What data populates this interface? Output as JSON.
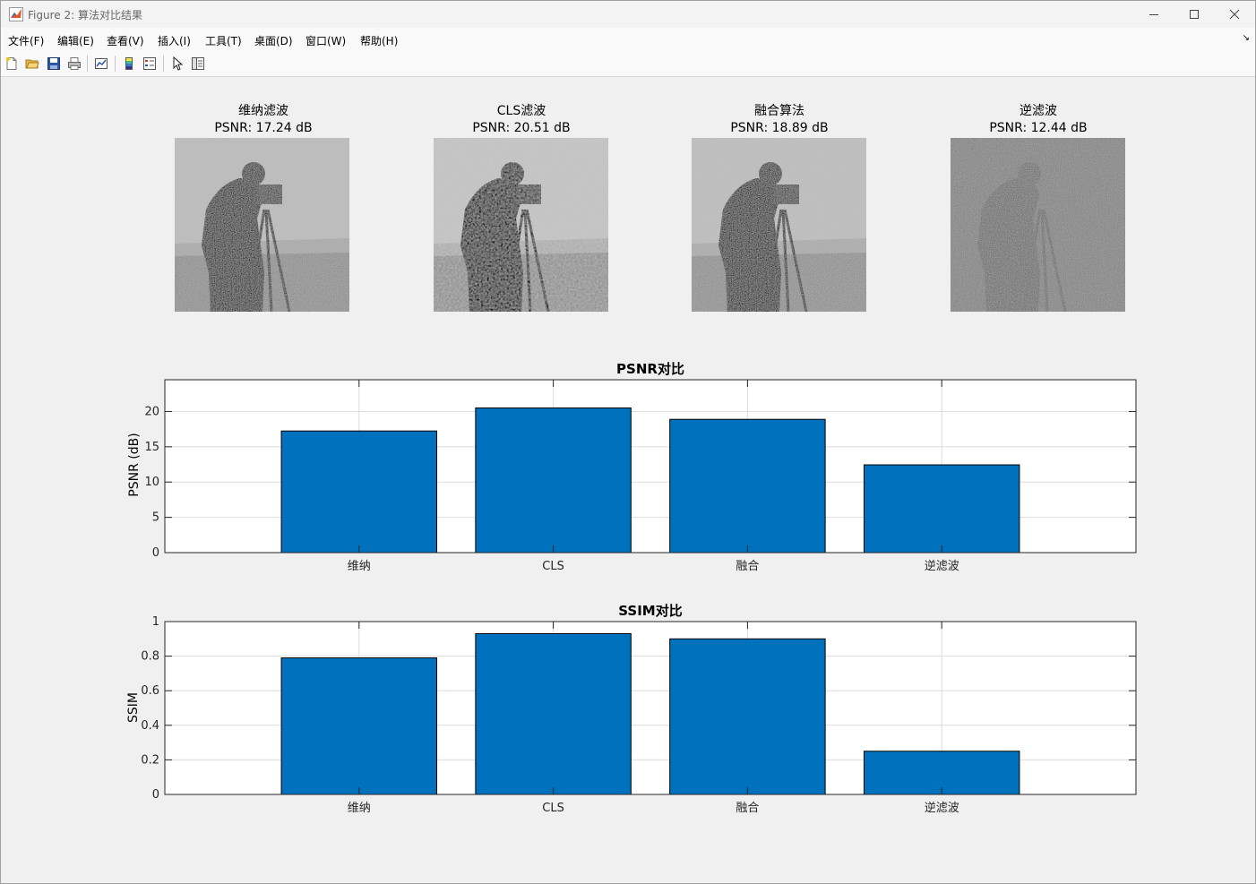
{
  "window": {
    "title": "Figure 2: 算法对比结果",
    "app_icon": "matlab-icon"
  },
  "menu": {
    "items": [
      "文件(F)",
      "编辑(E)",
      "查看(V)",
      "插入(I)",
      "工具(T)",
      "桌面(D)",
      "窗口(W)",
      "帮助(H)"
    ],
    "corner_glyph": "↘"
  },
  "toolbar": {
    "icons": [
      "new-figure-icon",
      "open-file-icon",
      "save-icon",
      "print-icon",
      "link-plot-icon",
      "insert-colorbar-icon",
      "insert-legend-icon",
      "edit-plot-icon",
      "property-inspector-icon"
    ]
  },
  "images": [
    {
      "title": "维纳滤波",
      "psnr": "PSNR: 17.24 dB"
    },
    {
      "title": "CLS滤波",
      "psnr": "PSNR: 20.51 dB"
    },
    {
      "title": "融合算法",
      "psnr": "PSNR: 18.89 dB"
    },
    {
      "title": "逆滤波",
      "psnr": "PSNR: 12.44 dB"
    }
  ],
  "colors": {
    "bar": "#0072BD",
    "grid": "#dcdcdc",
    "axes_bg": "#ffffff",
    "figure_bg": "#f0f0f0"
  },
  "chart_data": [
    {
      "type": "bar",
      "title": "PSNR对比",
      "xlabel": "",
      "ylabel": "PSNR (dB)",
      "categories": [
        "维纳",
        "CLS",
        "融合",
        "逆滤波"
      ],
      "values": [
        17.24,
        20.51,
        18.89,
        12.44
      ],
      "xlim": [
        0,
        5
      ],
      "ylim": [
        0,
        24.5
      ],
      "yticks": [
        0,
        5,
        10,
        15,
        20
      ],
      "ytick_labels": [
        "0",
        "5",
        "10",
        "15",
        "20"
      ],
      "grid": true
    },
    {
      "type": "bar",
      "title": "SSIM对比",
      "xlabel": "",
      "ylabel": "SSIM",
      "categories": [
        "维纳",
        "CLS",
        "融合",
        "逆滤波"
      ],
      "values": [
        0.79,
        0.93,
        0.9,
        0.25
      ],
      "xlim": [
        0,
        5
      ],
      "ylim": [
        0,
        1
      ],
      "yticks": [
        0,
        0.2,
        0.4,
        0.6,
        0.8,
        1
      ],
      "ytick_labels": [
        "0",
        "0.2",
        "0.4",
        "0.6",
        "0.8",
        "1"
      ],
      "grid": true
    }
  ]
}
